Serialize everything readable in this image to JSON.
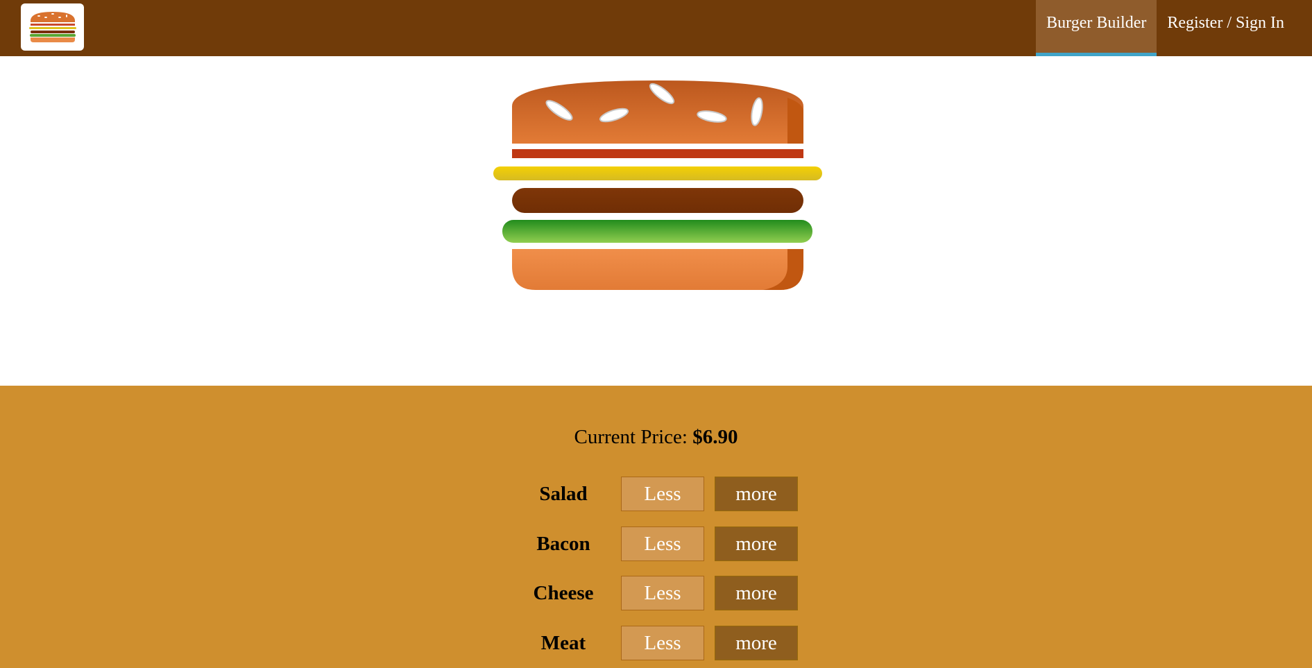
{
  "nav": {
    "items": [
      {
        "label": "Burger Builder",
        "active": true
      },
      {
        "label": "Register / Sign In",
        "active": false
      }
    ]
  },
  "logo": {
    "icon": "burger-logo-icon"
  },
  "burger": {
    "layers": [
      "bread-top",
      "bacon",
      "cheese",
      "meat",
      "salad",
      "bread-bottom"
    ]
  },
  "build_controls": {
    "price_label": "Current Price:",
    "price_value": "$6.90",
    "controls": [
      {
        "label": "Salad",
        "less": "Less",
        "more": "more"
      },
      {
        "label": "Bacon",
        "less": "Less",
        "more": "more"
      },
      {
        "label": "Cheese",
        "less": "Less",
        "more": "more"
      },
      {
        "label": "Meat",
        "less": "Less",
        "more": "more"
      }
    ]
  },
  "colors": {
    "toolbar": "#703b09",
    "active_nav": "#8f5c2c",
    "active_indicator": "#40a4c8",
    "controls_bg": "#cf8f2e",
    "less_button": "#d39952",
    "more_button": "#8f5e1e"
  }
}
